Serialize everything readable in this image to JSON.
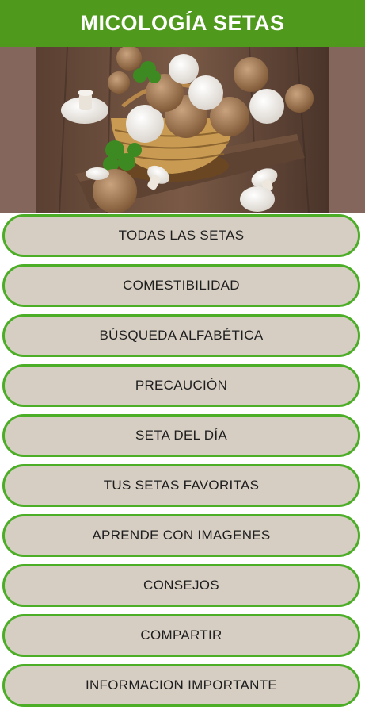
{
  "app": {
    "title": "MICOLOGÍA SETAS"
  },
  "hero": {
    "image": "mushroom-basket-photo"
  },
  "menu": [
    {
      "id": "todas",
      "label": "TODAS LAS SETAS"
    },
    {
      "id": "comestibilidad",
      "label": "COMESTIBILIDAD"
    },
    {
      "id": "busqueda",
      "label": "BÚSQUEDA ALFABÉTICA"
    },
    {
      "id": "precaucion",
      "label": "PRECAUCIÓN"
    },
    {
      "id": "seta-dia",
      "label": "SETA DEL DÍA"
    },
    {
      "id": "favoritas",
      "label": "TUS SETAS FAVORITAS"
    },
    {
      "id": "aprende",
      "label": "APRENDE CON IMAGENES"
    },
    {
      "id": "consejos",
      "label": "CONSEJOS"
    },
    {
      "id": "compartir",
      "label": "COMPARTIR"
    },
    {
      "id": "informacion",
      "label": "INFORMACION IMPORTANTE"
    }
  ],
  "colors": {
    "appbar": "#4f9a1c",
    "button_border": "#4cae27",
    "button_fill": "#d6cec3",
    "hero_background": "#85665c"
  }
}
